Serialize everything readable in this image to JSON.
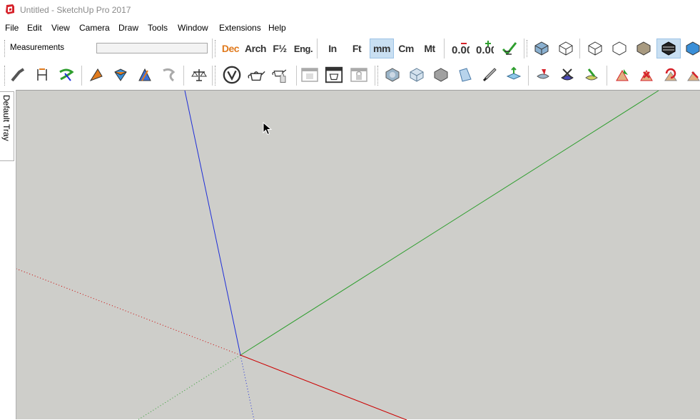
{
  "window": {
    "title": "Untitled - SketchUp Pro 2017"
  },
  "menubar": {
    "items": [
      "File",
      "Edit",
      "View",
      "Camera",
      "Draw",
      "Tools",
      "Window",
      "Extensions",
      "Help"
    ]
  },
  "measurements": {
    "label": "Measurements",
    "value": ""
  },
  "units_toolbar": {
    "buttons": [
      "Dec",
      "Arch",
      "F½",
      "Eng.",
      "In",
      "Ft",
      "mm",
      "Cm",
      "Mt"
    ],
    "active": "mm",
    "precision_decrease": "0.00",
    "precision_increase": "0.00"
  },
  "tray": {
    "label": "Default Tray"
  },
  "colors": {
    "viewport_bg": "#cececa",
    "axis_red": "#cc0000",
    "axis_green": "#2e9e2e",
    "axis_blue": "#1e2ed8",
    "active_button": "#c9dff2",
    "sketchup_red": "#d6222a"
  }
}
